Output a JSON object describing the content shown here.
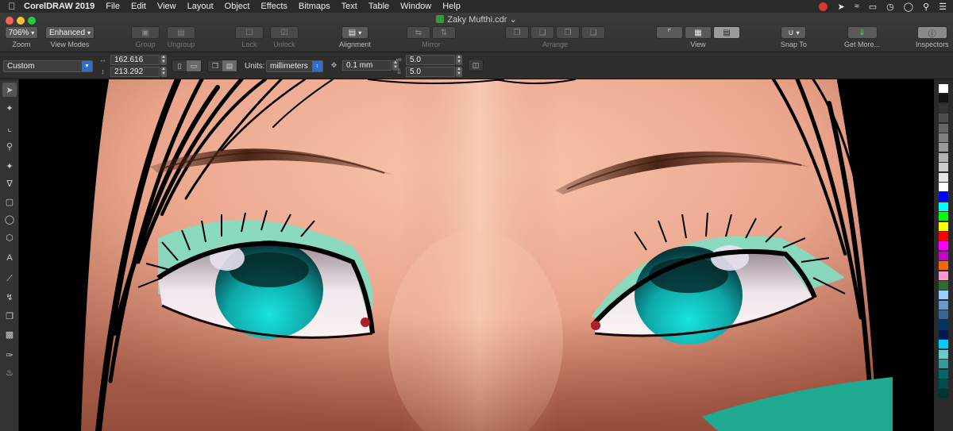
{
  "menubar": {
    "app_name": "CorelDRAW 2019",
    "items": [
      "File",
      "Edit",
      "View",
      "Layout",
      "Object",
      "Effects",
      "Bitmaps",
      "Text",
      "Table",
      "Window",
      "Help"
    ]
  },
  "window": {
    "title": "Zaky Mufthi.cdr",
    "title_suffix": "⌄"
  },
  "toolbar": {
    "zoom": {
      "value": "706%",
      "label": "Zoom"
    },
    "view_modes": {
      "value": "Enhanced",
      "label": "View Modes"
    },
    "group": {
      "label": "Group"
    },
    "ungroup": {
      "label": "Ungroup"
    },
    "lock": {
      "label": "Lock"
    },
    "unlock": {
      "label": "Unlock"
    },
    "alignment": {
      "label": "Alignment"
    },
    "mirror": {
      "label": "Mirror"
    },
    "arrange": {
      "label": "Arrange"
    },
    "view": {
      "label": "View"
    },
    "snap_to": {
      "label": "Snap To"
    },
    "get_more": {
      "label": "Get More..."
    },
    "inspectors": {
      "label": "Inspectors"
    }
  },
  "propbar": {
    "page_size": "Custom",
    "width": "162.616",
    "height": "213.292",
    "units_label": "Units:",
    "units_value": "millimeters",
    "nudge": "0.1 mm",
    "dup_x": "5.0",
    "dup_y": "5.0"
  },
  "palette": {
    "colors": [
      "#ffffff",
      "#111111",
      "#333333",
      "#4d4d4d",
      "#666666",
      "#808080",
      "#999999",
      "#b3b3b3",
      "#cccccc",
      "#e6e6e6",
      "#ffffff",
      "#0000ff",
      "#00ffff",
      "#00ff00",
      "#ffff00",
      "#ff0000",
      "#ff00ff",
      "#cc00cc",
      "#ff6600",
      "#ff99cc",
      "#2e6b2e",
      "#99ccff",
      "#6699cc",
      "#336699",
      "#003366",
      "#001a4d",
      "#00ccff",
      "#66cccc",
      "#339999",
      "#006666",
      "#004d4d",
      "#003333"
    ]
  }
}
